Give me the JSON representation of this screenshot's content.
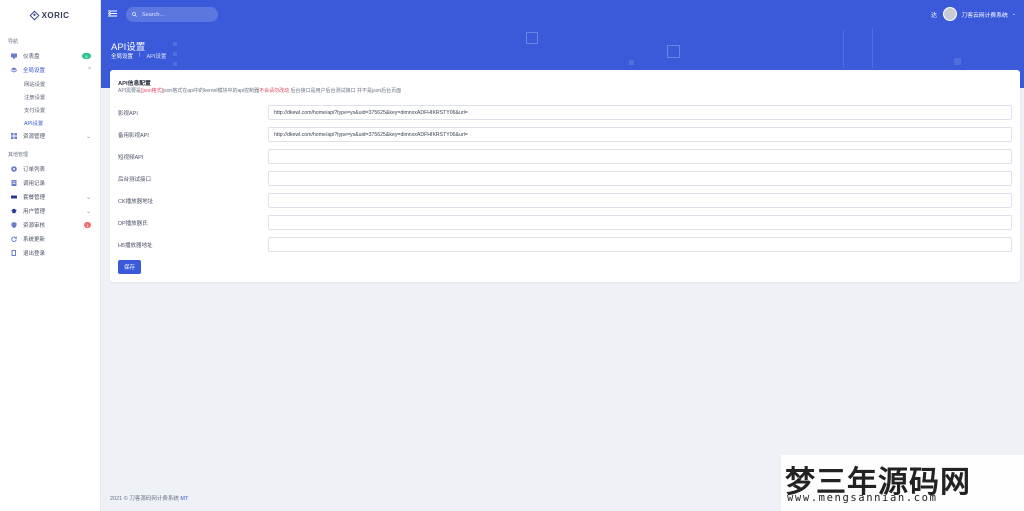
{
  "app": {
    "logo_text": "XORIC"
  },
  "sidebar": {
    "section_nav": "导航",
    "section_other": "其他管理",
    "items": [
      {
        "label": "仪表盘",
        "icon": "dashboard-icon",
        "badge": "6",
        "badge_color": "#34c38f"
      },
      {
        "label": "全局设置",
        "icon": "settings-icon",
        "chevron": "^"
      },
      {
        "label": "资源管理",
        "icon": "grid-icon",
        "chevron": "⌄"
      },
      {
        "label": "订单列表",
        "icon": "order-icon"
      },
      {
        "label": "调用记录",
        "icon": "record-icon"
      },
      {
        "label": "套餐管理",
        "icon": "package-icon",
        "chevron": "⌄"
      },
      {
        "label": "用户管理",
        "icon": "users-icon",
        "chevron": "⌄"
      },
      {
        "label": "资源审核",
        "icon": "review-icon",
        "badge": "1",
        "badge_color": "#f46a6a"
      },
      {
        "label": "系统更新",
        "icon": "update-icon"
      },
      {
        "label": "退出登录",
        "icon": "logout-icon"
      }
    ],
    "sub_items": [
      "网站设置",
      "注册设置",
      "支付设置",
      "API设置"
    ]
  },
  "header": {
    "search_placeholder": "Search...",
    "lang": "达",
    "username": "刀客云网计费系统"
  },
  "page": {
    "title": "API设置",
    "breadcrumb": [
      "全局设置",
      "API设置"
    ]
  },
  "card": {
    "title": "API信息配置",
    "desc_prefix": "API需要是",
    "desc_hl1": "[json格式]",
    "desc_mid": "json格式在api中的kernel模块中的api控制器",
    "desc_hl2": "不会请勿改动",
    "desc_suffix": " 后台接口是用户后台测试接口 并不是json后台页面",
    "fields": [
      {
        "label": "影视API",
        "value": "http://dkewl.com/home/api?type=ys&uid=375625&key=dimnxxADFHIKRSTY06&url="
      },
      {
        "label": "备用影视API",
        "value": "http://dkewl.com/home/api?type=ys&uid=375625&key=dimnxxADFHIKRSTY06&url="
      },
      {
        "label": "短视频API",
        "value": ""
      },
      {
        "label": "后台测试接口",
        "value": ""
      },
      {
        "label": "CK播放器地址",
        "value": ""
      },
      {
        "label": "DP播放器氏",
        "value": ""
      },
      {
        "label": "H5播放器地址",
        "value": ""
      }
    ],
    "save_label": "保存"
  },
  "footer": {
    "text": "2021 © 刀客源码网计费系统",
    "brand": "MT"
  },
  "watermark": {
    "big": "梦三年源码网",
    "small": "www.mengsannian.com"
  },
  "colors": {
    "primary": "#3a5ad9",
    "highlight": "#e24a67"
  }
}
